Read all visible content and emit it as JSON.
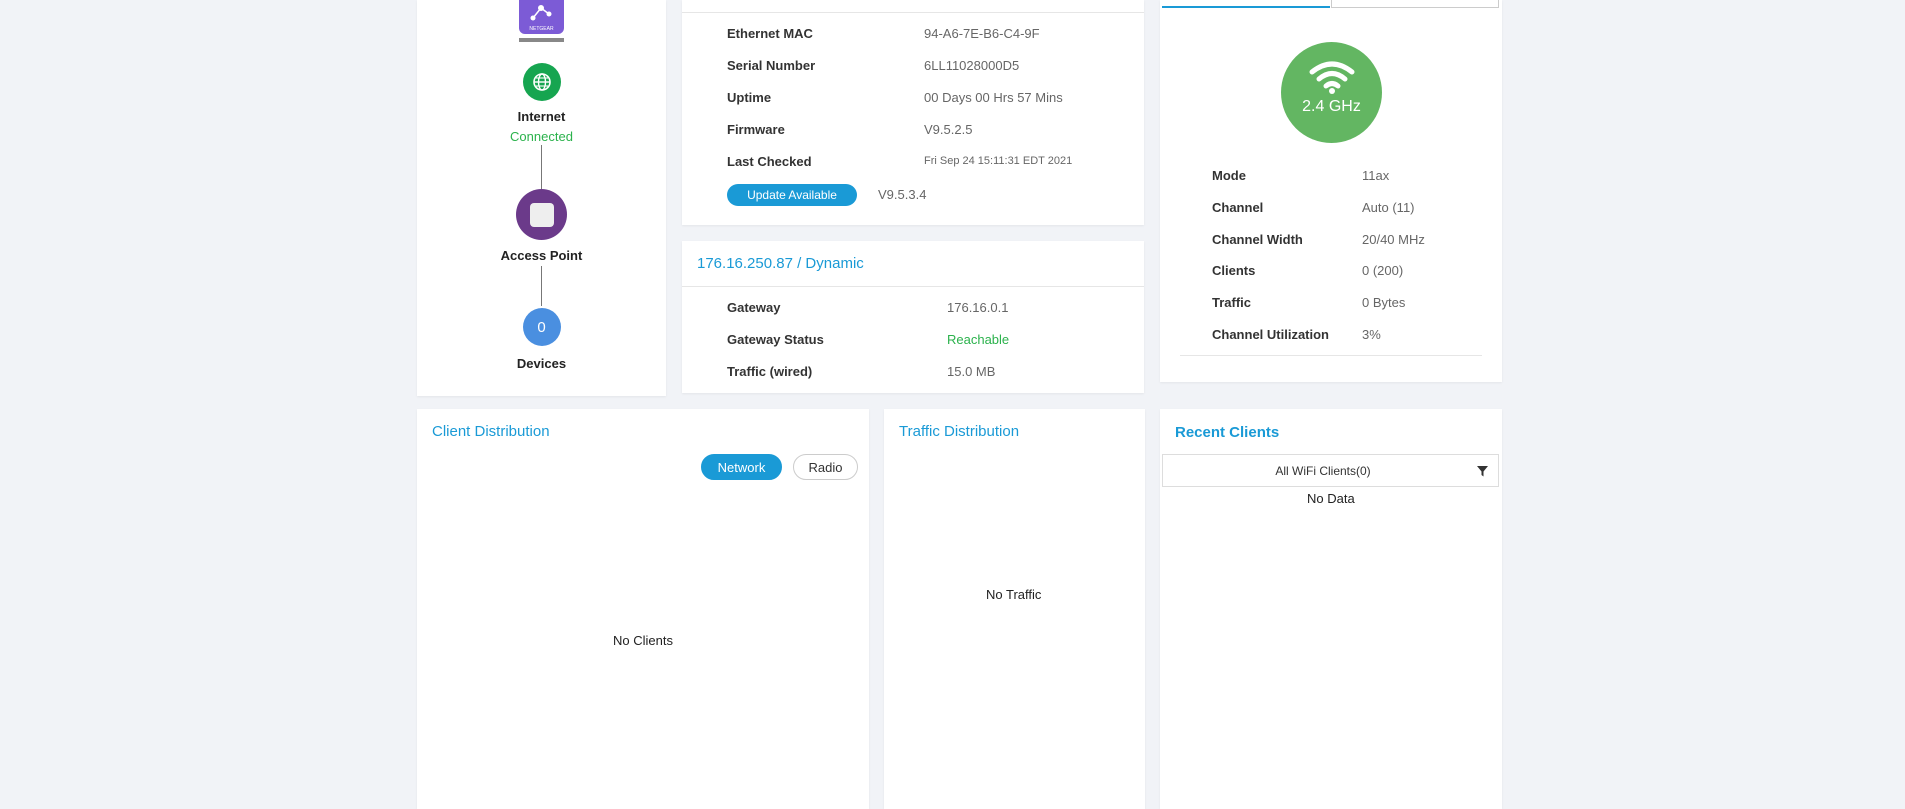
{
  "topology": {
    "router_brand": "NETGEAR",
    "internet_label": "Internet",
    "internet_status": "Connected",
    "ap_label": "Access Point",
    "devices_count": "0",
    "devices_label": "Devices",
    "colors": {
      "internet": "#16a550",
      "ap": "#6b3a8a",
      "devices": "#4a8fe0",
      "router": "#7c5bd6"
    }
  },
  "device_info": {
    "rows": [
      {
        "key": "Ethernet MAC",
        "value": "94-A6-7E-B6-C4-9F"
      },
      {
        "key": "Serial Number",
        "value": "6LL11028000D5"
      },
      {
        "key": "Uptime",
        "value": "00 Days 00 Hrs 57 Mins"
      },
      {
        "key": "Firmware",
        "value": "V9.5.2.5"
      },
      {
        "key": "Last Checked",
        "value": "Fri Sep 24 15:11:31 EDT 2021"
      }
    ],
    "update_button": "Update Available",
    "update_version": "V9.5.3.4"
  },
  "ip_info": {
    "title": "176.16.250.87 / Dynamic",
    "rows": [
      {
        "key": "Gateway",
        "value": "176.16.0.1"
      },
      {
        "key": "Gateway Status",
        "value": "Reachable"
      },
      {
        "key": "Traffic (wired)",
        "value": "15.0 MB"
      }
    ]
  },
  "radio": {
    "band": "2.4 GHz",
    "rows": [
      {
        "key": "Mode",
        "value": "11ax"
      },
      {
        "key": "Channel",
        "value": "Auto (11)"
      },
      {
        "key": "Channel Width",
        "value": "20/40 MHz"
      },
      {
        "key": "Clients",
        "value": "0 (200)"
      },
      {
        "key": "Traffic",
        "value": "0 Bytes"
      },
      {
        "key": "Channel Utilization",
        "value": "3%"
      }
    ]
  },
  "client_distribution": {
    "title": "Client Distribution",
    "toggle_network": "Network",
    "toggle_radio": "Radio",
    "empty": "No Clients"
  },
  "traffic_distribution": {
    "title": "Traffic Distribution",
    "empty": "No Traffic"
  },
  "recent_clients": {
    "title": "Recent Clients",
    "filter_label": "All WiFi Clients(0)",
    "empty": "No Data"
  },
  "accent": "#1a9ad6",
  "status_ok": "#2bb24c"
}
